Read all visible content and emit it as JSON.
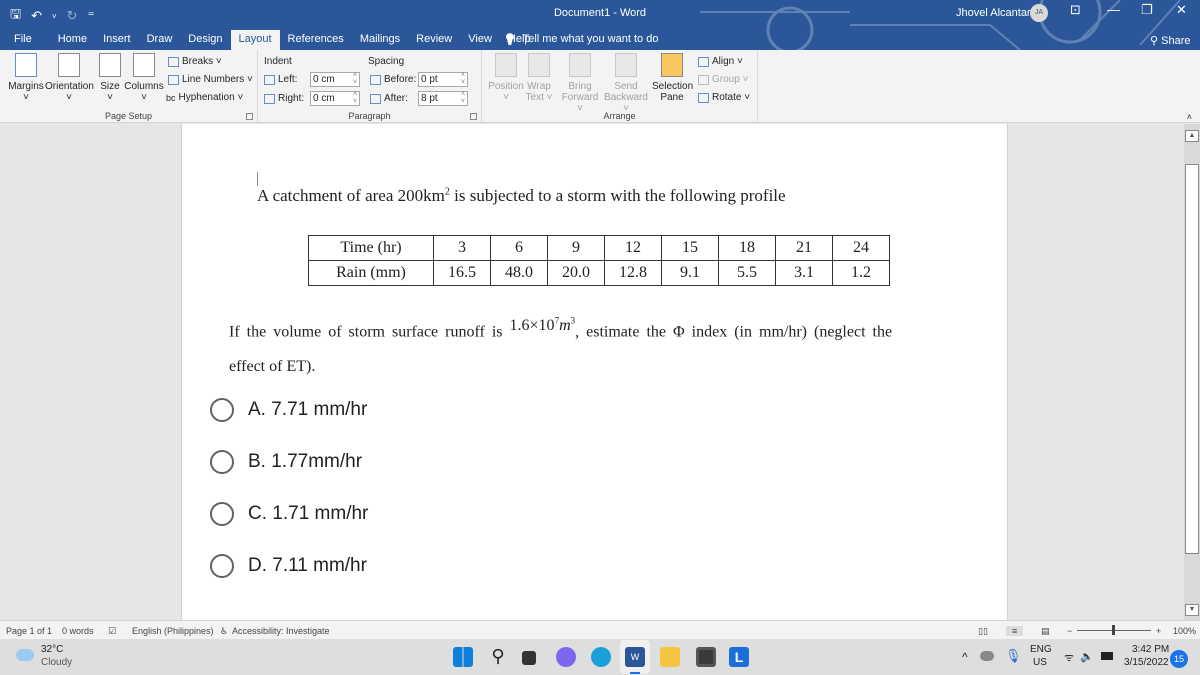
{
  "titlebar": {
    "doc_title": "Document1  -  Word",
    "user_name": "Jhovel Alcantara",
    "user_initials": "JA",
    "qat": {
      "save": "🖫",
      "undo": "↶",
      "undo_more": "˅",
      "redo": "↻",
      "customize": "⁼"
    },
    "controls": {
      "ribbon_display": "⊡",
      "minimize": "—",
      "restore": "❐",
      "close": "✕"
    }
  },
  "tabs": [
    "File",
    "Home",
    "Insert",
    "Draw",
    "Design",
    "Layout",
    "References",
    "Mailings",
    "Review",
    "View",
    "Help"
  ],
  "active_tab": "Layout",
  "tell_me": {
    "icon": "💡",
    "text": "Tell me what you want to do"
  },
  "share": "Share",
  "ribbon": {
    "page_setup": {
      "label": "Page Setup",
      "margins": "Margins",
      "orientation": "Orientation",
      "size": "Size",
      "columns": "Columns",
      "breaks": "Breaks ˅",
      "line_numbers": "Line Numbers ˅",
      "hyphenation": "Hyphenation ˅"
    },
    "paragraph": {
      "label": "Paragraph",
      "indent_label": "Indent",
      "spacing_label": "Spacing",
      "left_label": "Left:",
      "left_value": "0 cm",
      "right_label": "Right:",
      "right_value": "0 cm",
      "before_label": "Before:",
      "before_value": "0 pt",
      "after_label": "After:",
      "after_value": "8 pt"
    },
    "arrange": {
      "label": "Arrange",
      "position": "Position",
      "wrap_text": "Wrap Text ˅",
      "bring_forward": "Bring Forward ˅",
      "send_backward": "Send Backward ˅",
      "selection_pane": "Selection Pane",
      "align": "Align ˅",
      "group": "Group ˅",
      "rotate": "Rotate ˅"
    }
  },
  "document": {
    "intro_text": "A catchment of area 200km",
    "intro_sup": "2",
    "intro_rest": " is subjected to a storm with the following profile",
    "table": {
      "row1_header": "Time (hr)",
      "row1": [
        "3",
        "6",
        "9",
        "12",
        "15",
        "18",
        "21",
        "24"
      ],
      "row2_header": "Rain (mm)",
      "row2": [
        "16.5",
        "48.0",
        "20.0",
        "12.8",
        "9.1",
        "5.5",
        "3.1",
        "1.2"
      ]
    },
    "question_part1": "If the volume of storm surface runoff is ",
    "question_formula": "1.6×10",
    "question_exp": "7",
    "question_unit": "m",
    "question_unit_exp": "3",
    "question_part2": ", estimate the Φ index (in mm/hr) (neglect the",
    "question_line2": "effect of ET).",
    "options": [
      "A. 7.71 mm/hr",
      "B. 1.77mm/hr",
      "C. 1.71 mm/hr",
      "D. 7.11 mm/hr"
    ]
  },
  "status_bar": {
    "page": "Page 1 of 1",
    "words": "0 words",
    "language": "English (Philippines)",
    "accessibility": "Accessibility: Investigate",
    "zoom": "100%",
    "zoom_minus": "−",
    "zoom_plus": "+"
  },
  "taskbar": {
    "temperature": "32°C",
    "weather": "Cloudy",
    "lang_top": "ENG",
    "lang_bottom": "US",
    "time": "3:42 PM",
    "date": "3/15/2022",
    "notifications": "15",
    "tray_chevron": "^"
  },
  "colors": {
    "word_blue": "#2b579a",
    "taskbar_bg": "#dedede",
    "badge": "#1a73e8"
  }
}
